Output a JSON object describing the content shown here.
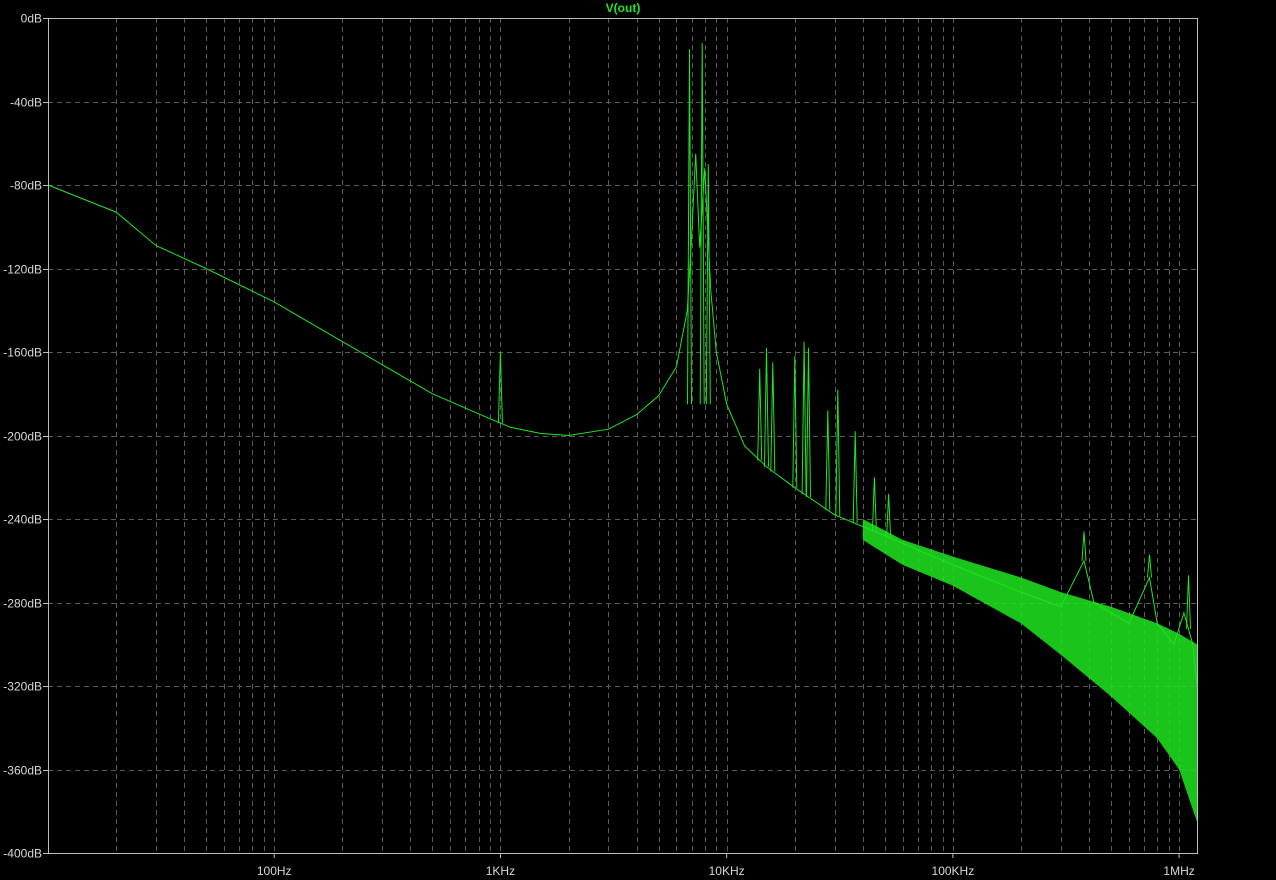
{
  "window": {
    "background": "#000000",
    "trace_color": "#1ee61e",
    "grid_color": "#5a5a5a",
    "frame_color": "#bdbdbd",
    "label_color": "#d8d8d8"
  },
  "chart_data": {
    "type": "line",
    "title": "V(out)",
    "xlabel": "",
    "ylabel": "",
    "xscale": "log",
    "xlim_hz": [
      10,
      1200000
    ],
    "ylim_db": [
      -400,
      0
    ],
    "grid": true,
    "y_ticks": [
      {
        "value": 0,
        "label": "0dB"
      },
      {
        "value": -40,
        "label": "-40dB"
      },
      {
        "value": -80,
        "label": "-80dB"
      },
      {
        "value": -120,
        "label": "-120dB"
      },
      {
        "value": -160,
        "label": "-160dB"
      },
      {
        "value": -200,
        "label": "-200dB"
      },
      {
        "value": -240,
        "label": "-240dB"
      },
      {
        "value": -280,
        "label": "-280dB"
      },
      {
        "value": -320,
        "label": "-320dB"
      },
      {
        "value": -360,
        "label": "-360dB"
      },
      {
        "value": -400,
        "label": "-400dB"
      }
    ],
    "x_ticks": [
      {
        "value": 100,
        "label": "100Hz"
      },
      {
        "value": 1000,
        "label": "1KHz"
      },
      {
        "value": 10000,
        "label": "10KHz"
      },
      {
        "value": 100000,
        "label": "100KHz"
      },
      {
        "value": 1000000,
        "label": "1MHz"
      }
    ],
    "series": [
      {
        "name": "V(out)",
        "x": [
          10,
          20,
          30,
          50,
          100,
          200,
          500,
          900,
          1000,
          1100,
          1500,
          2000,
          3000,
          4000,
          5000,
          6000,
          6700,
          7000,
          7300,
          7600,
          8000,
          8500,
          9000,
          10000,
          12000,
          15000,
          20000,
          30000,
          50000,
          100000,
          200000,
          300000,
          380000,
          420000,
          600000,
          740000,
          800000,
          950000,
          1050000,
          1150000,
          1200000
        ],
        "y": [
          -80,
          -93,
          -109,
          -120,
          -136,
          -155,
          -180,
          -192,
          -194,
          -196,
          -199,
          -200,
          -197,
          -190,
          -181,
          -167,
          -140,
          -105,
          -65,
          -110,
          -72,
          -130,
          -160,
          -185,
          -205,
          -215,
          -225,
          -238,
          -248,
          -262,
          -275,
          -282,
          -260,
          -280,
          -290,
          -268,
          -290,
          -300,
          -285,
          -300,
          -320
        ],
        "spikes": [
          {
            "x": 1000,
            "y": -160
          },
          {
            "x": 6850,
            "y": -15
          },
          {
            "x": 7800,
            "y": -12
          },
          {
            "x": 8300,
            "y": -70
          },
          {
            "x": 14000,
            "y": -168
          },
          {
            "x": 15000,
            "y": -158
          },
          {
            "x": 16000,
            "y": -165
          },
          {
            "x": 20000,
            "y": -162
          },
          {
            "x": 22000,
            "y": -155
          },
          {
            "x": 23000,
            "y": -158
          },
          {
            "x": 28000,
            "y": -188
          },
          {
            "x": 31000,
            "y": -178
          },
          {
            "x": 37000,
            "y": -198
          },
          {
            "x": 45000,
            "y": -220
          },
          {
            "x": 52000,
            "y": -228
          },
          {
            "x": 380000,
            "y": -246
          },
          {
            "x": 740000,
            "y": -257
          },
          {
            "x": 1100000,
            "y": -267
          }
        ],
        "noise_band": {
          "x": [
            40000,
            60000,
            100000,
            200000,
            300000,
            500000,
            800000,
            1000000,
            1200000
          ],
          "upper": [
            -240,
            -250,
            -258,
            -268,
            -275,
            -282,
            -290,
            -295,
            -300
          ],
          "lower": [
            -250,
            -262,
            -272,
            -290,
            -305,
            -325,
            -345,
            -360,
            -385
          ]
        }
      }
    ]
  }
}
